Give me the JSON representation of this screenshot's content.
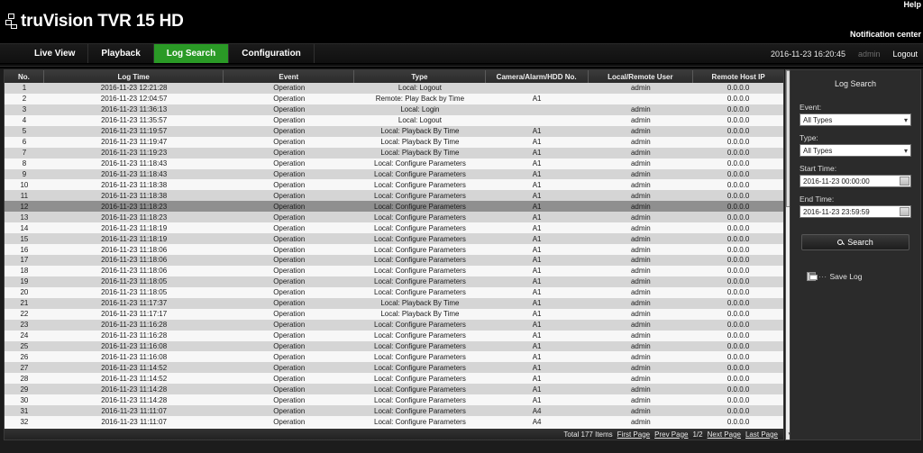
{
  "header": {
    "brand": "truVision TVR 15 HD",
    "logo_icon": "truvision-logo-icon",
    "help_label": "Help",
    "notification_label": "Notification center"
  },
  "nav": {
    "items": [
      {
        "label": "Live View",
        "active": false
      },
      {
        "label": "Playback",
        "active": false
      },
      {
        "label": "Log Search",
        "active": true
      },
      {
        "label": "Configuration",
        "active": false
      }
    ],
    "active_color": "#2a9a26",
    "datetime": "2016-11-23 16:20:45",
    "user": "admin",
    "logout_label": "Logout"
  },
  "table": {
    "columns": [
      "No.",
      "Log Time",
      "Event",
      "Type",
      "Camera/Alarm/HDD No.",
      "Local/Remote User",
      "Remote Host IP"
    ],
    "selected_row_index": 11,
    "rows": [
      [
        "1",
        "2016-11-23 12:21:28",
        "Operation",
        "Local: Logout",
        "",
        "admin",
        "0.0.0.0"
      ],
      [
        "2",
        "2016-11-23 12:04:57",
        "Operation",
        "Remote: Play Back by Time",
        "A1",
        "",
        "0.0.0.0"
      ],
      [
        "3",
        "2016-11-23 11:36:13",
        "Operation",
        "Local: Login",
        "",
        "admin",
        "0.0.0.0"
      ],
      [
        "4",
        "2016-11-23 11:35:57",
        "Operation",
        "Local: Logout",
        "",
        "admin",
        "0.0.0.0"
      ],
      [
        "5",
        "2016-11-23 11:19:57",
        "Operation",
        "Local: Playback By Time",
        "A1",
        "admin",
        "0.0.0.0"
      ],
      [
        "6",
        "2016-11-23 11:19:47",
        "Operation",
        "Local: Playback By Time",
        "A1",
        "admin",
        "0.0.0.0"
      ],
      [
        "7",
        "2016-11-23 11:19:23",
        "Operation",
        "Local: Playback By Time",
        "A1",
        "admin",
        "0.0.0.0"
      ],
      [
        "8",
        "2016-11-23 11:18:43",
        "Operation",
        "Local: Configure Parameters",
        "A1",
        "admin",
        "0.0.0.0"
      ],
      [
        "9",
        "2016-11-23 11:18:43",
        "Operation",
        "Local: Configure Parameters",
        "A1",
        "admin",
        "0.0.0.0"
      ],
      [
        "10",
        "2016-11-23 11:18:38",
        "Operation",
        "Local: Configure Parameters",
        "A1",
        "admin",
        "0.0.0.0"
      ],
      [
        "11",
        "2016-11-23 11:18:38",
        "Operation",
        "Local: Configure Parameters",
        "A1",
        "admin",
        "0.0.0.0"
      ],
      [
        "12",
        "2016-11-23 11:18:23",
        "Operation",
        "Local: Configure Parameters",
        "A1",
        "admin",
        "0.0.0.0"
      ],
      [
        "13",
        "2016-11-23 11:18:23",
        "Operation",
        "Local: Configure Parameters",
        "A1",
        "admin",
        "0.0.0.0"
      ],
      [
        "14",
        "2016-11-23 11:18:19",
        "Operation",
        "Local: Configure Parameters",
        "A1",
        "admin",
        "0.0.0.0"
      ],
      [
        "15",
        "2016-11-23 11:18:19",
        "Operation",
        "Local: Configure Parameters",
        "A1",
        "admin",
        "0.0.0.0"
      ],
      [
        "16",
        "2016-11-23 11:18:06",
        "Operation",
        "Local: Configure Parameters",
        "A1",
        "admin",
        "0.0.0.0"
      ],
      [
        "17",
        "2016-11-23 11:18:06",
        "Operation",
        "Local: Configure Parameters",
        "A1",
        "admin",
        "0.0.0.0"
      ],
      [
        "18",
        "2016-11-23 11:18:06",
        "Operation",
        "Local: Configure Parameters",
        "A1",
        "admin",
        "0.0.0.0"
      ],
      [
        "19",
        "2016-11-23 11:18:05",
        "Operation",
        "Local: Configure Parameters",
        "A1",
        "admin",
        "0.0.0.0"
      ],
      [
        "20",
        "2016-11-23 11:18:05",
        "Operation",
        "Local: Configure Parameters",
        "A1",
        "admin",
        "0.0.0.0"
      ],
      [
        "21",
        "2016-11-23 11:17:37",
        "Operation",
        "Local: Playback By Time",
        "A1",
        "admin",
        "0.0.0.0"
      ],
      [
        "22",
        "2016-11-23 11:17:17",
        "Operation",
        "Local: Playback By Time",
        "A1",
        "admin",
        "0.0.0.0"
      ],
      [
        "23",
        "2016-11-23 11:16:28",
        "Operation",
        "Local: Configure Parameters",
        "A1",
        "admin",
        "0.0.0.0"
      ],
      [
        "24",
        "2016-11-23 11:16:28",
        "Operation",
        "Local: Configure Parameters",
        "A1",
        "admin",
        "0.0.0.0"
      ],
      [
        "25",
        "2016-11-23 11:16:08",
        "Operation",
        "Local: Configure Parameters",
        "A1",
        "admin",
        "0.0.0.0"
      ],
      [
        "26",
        "2016-11-23 11:16:08",
        "Operation",
        "Local: Configure Parameters",
        "A1",
        "admin",
        "0.0.0.0"
      ],
      [
        "27",
        "2016-11-23 11:14:52",
        "Operation",
        "Local: Configure Parameters",
        "A1",
        "admin",
        "0.0.0.0"
      ],
      [
        "28",
        "2016-11-23 11:14:52",
        "Operation",
        "Local: Configure Parameters",
        "A1",
        "admin",
        "0.0.0.0"
      ],
      [
        "29",
        "2016-11-23 11:14:28",
        "Operation",
        "Local: Configure Parameters",
        "A1",
        "admin",
        "0.0.0.0"
      ],
      [
        "30",
        "2016-11-23 11:14:28",
        "Operation",
        "Local: Configure Parameters",
        "A1",
        "admin",
        "0.0.0.0"
      ],
      [
        "31",
        "2016-11-23 11:11:07",
        "Operation",
        "Local: Configure Parameters",
        "A4",
        "admin",
        "0.0.0.0"
      ],
      [
        "32",
        "2016-11-23 11:11:07",
        "Operation",
        "Local: Configure Parameters",
        "A4",
        "admin",
        "0.0.0.0"
      ]
    ]
  },
  "pager": {
    "total_label": "Total 177 Items",
    "first_page": "First Page",
    "prev_page": "Prev Page",
    "page_indicator": "1/2",
    "next_page": "Next Page",
    "last_page": "Last Page"
  },
  "panel": {
    "title": "Log Search",
    "event_label": "Event:",
    "event_value": "All Types",
    "type_label": "Type:",
    "type_value": "All Types",
    "start_label": "Start Time:",
    "start_value": "2016-11-23 00:00:00",
    "end_label": "End Time:",
    "end_value": "2016-11-23 23:59:59",
    "search_label": "Search",
    "save_log_label": "Save Log",
    "save_log_dots": "···"
  }
}
